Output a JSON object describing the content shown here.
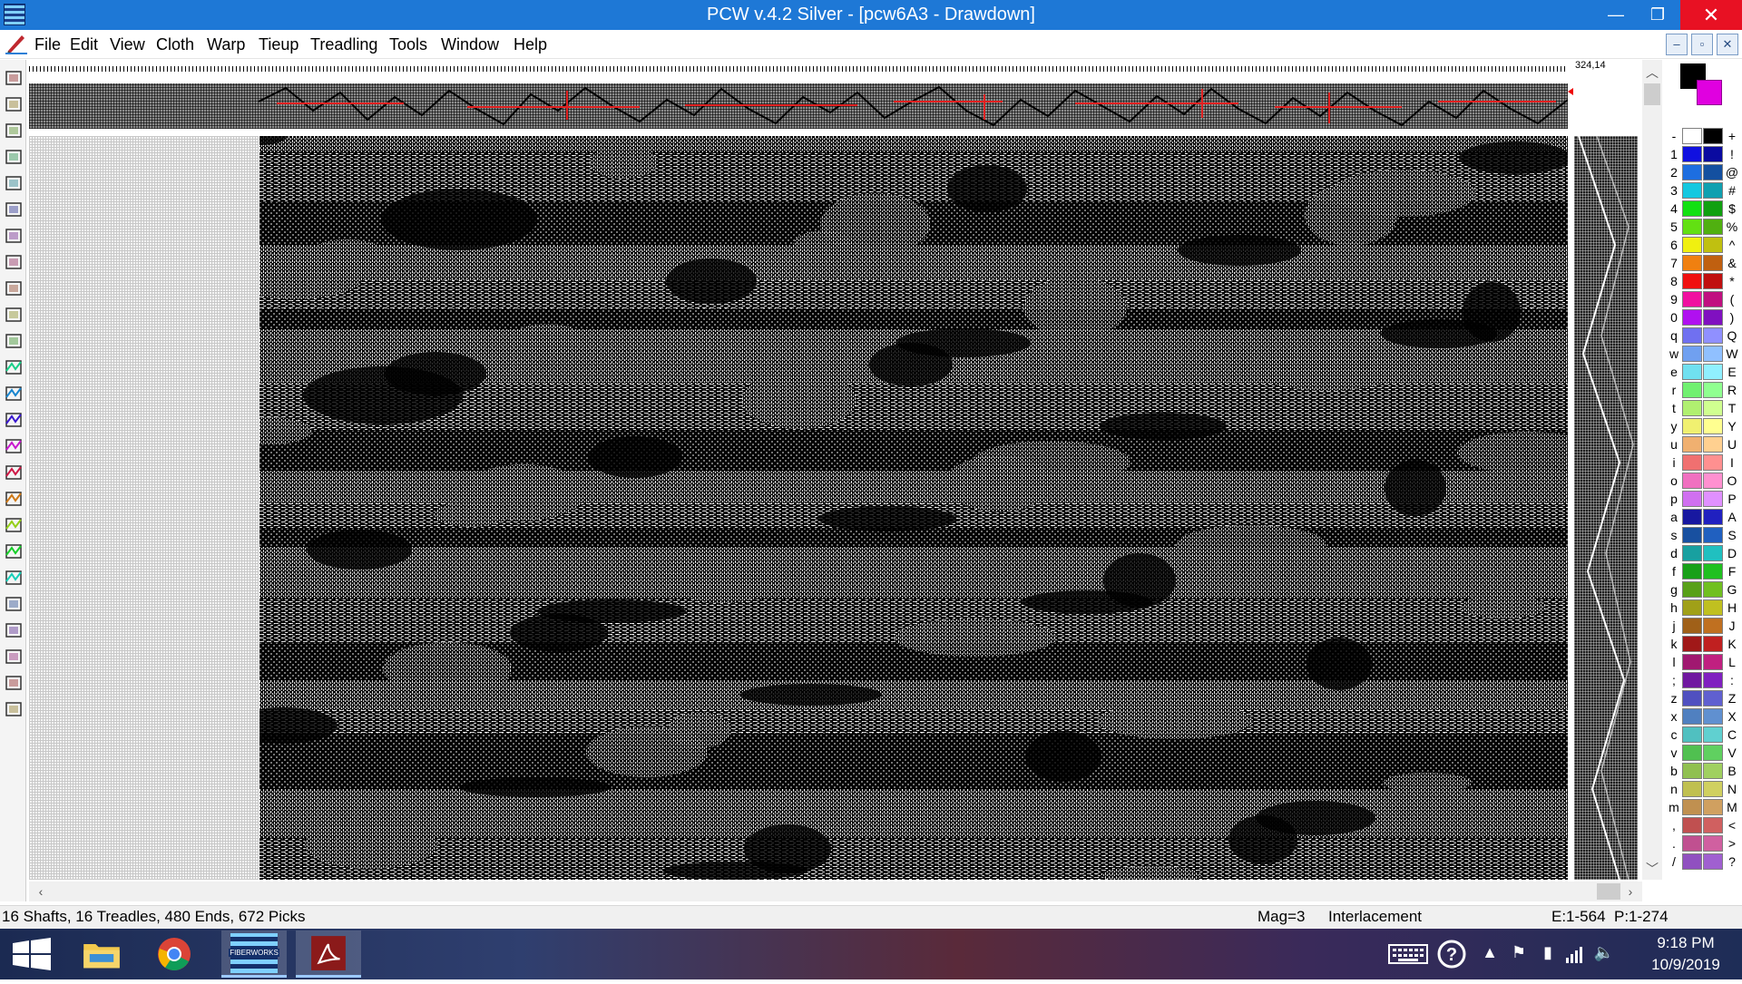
{
  "window": {
    "title": "PCW v.4.2 Silver - [pcw6A3 - Drawdown]",
    "minimize": "—",
    "restore": "❐",
    "close": "✕"
  },
  "menu": [
    "File",
    "Edit",
    "View",
    "Cloth",
    "Warp",
    "Tieup",
    "Treadling",
    "Tools",
    "Window",
    "Help"
  ],
  "mdi_buttons": [
    "–",
    "▫",
    "✕"
  ],
  "toolbar": {
    "icons": [
      "new-file-icon",
      "open-folder-icon",
      "save-icon",
      "print-icon",
      "undo-icon",
      "cut-icon",
      "copy-icon",
      "paste-icon",
      "color-block-icon",
      "select-rectangle-icon",
      "pencil-icon",
      "threading-pattern-1-icon",
      "threading-pattern-2-icon",
      "threading-pattern-3-icon",
      "threading-pattern-4-icon",
      "threading-pattern-5-icon",
      "mirror-pattern-icon",
      "repeat-pattern-icon",
      "weave-icon",
      "block-b-icon",
      "color-grid-icon",
      "color-stripe-icon",
      "zoom-in-icon",
      "zoom-out-icon",
      "help-pointer-icon"
    ]
  },
  "coord_readout": "324,14",
  "palette": {
    "left_keys": [
      "-",
      "1",
      "2",
      "3",
      "4",
      "5",
      "6",
      "7",
      "8",
      "9",
      "0",
      "q",
      "w",
      "e",
      "r",
      "t",
      "y",
      "u",
      "i",
      "o",
      "p",
      "a",
      "s",
      "d",
      "f",
      "g",
      "h",
      "j",
      "k",
      "l",
      ";",
      "z",
      "x",
      "c",
      "v",
      "b",
      "n",
      "m",
      ",",
      ".",
      " /"
    ],
    "right_keys": [
      "+",
      "!",
      "@",
      "#",
      "$",
      "%",
      "^",
      "&",
      "*",
      "(",
      ")",
      "Q",
      "W",
      "E",
      "R",
      "T",
      "Y",
      "U",
      "I",
      "O",
      "P",
      "A",
      "S",
      "D",
      "F",
      "G",
      "H",
      "J",
      "K",
      "L",
      ":",
      "Z",
      "X",
      "C",
      "V",
      "B",
      "N",
      "M",
      "<",
      ">",
      "?"
    ],
    "colors_a": [
      "#ffffff",
      "#1010e0",
      "#1d6ee0",
      "#14c8e0",
      "#12e012",
      "#62e012",
      "#f0f010",
      "#f08010",
      "#f01010",
      "#f010a0",
      "#b010f0",
      "#7070f0",
      "#70a0f0",
      "#70e0f0",
      "#70f070",
      "#b0f070",
      "#f0f070",
      "#f0b070",
      "#f07070",
      "#f070c0",
      "#d070f0",
      "#1818a0",
      "#1850a0",
      "#18a0a0",
      "#18a018",
      "#58a018",
      "#a0a018",
      "#a06018",
      "#a01818",
      "#a01870",
      "#7018a0",
      "#5050c0",
      "#5080c0",
      "#50c0c0",
      "#50c050",
      "#90c050",
      "#c0c050",
      "#c09050",
      "#c05050",
      "#c05090",
      "#9050c0"
    ],
    "colors_b": [
      "#000000",
      "#0a0aa0",
      "#1450a0",
      "#10a0b0",
      "#10a010",
      "#50b010",
      "#c0c010",
      "#c06010",
      "#c01010",
      "#c01080",
      "#8010c0",
      "#9090ff",
      "#90c0ff",
      "#90f0ff",
      "#90ff90",
      "#d0ff90",
      "#ffff90",
      "#ffd090",
      "#ff9090",
      "#ff90d0",
      "#e090ff",
      "#2020c0",
      "#2060c0",
      "#20c0c0",
      "#20c020",
      "#70c020",
      "#c0c020",
      "#c07020",
      "#c02020",
      "#c02080",
      "#8020c0",
      "#6060d0",
      "#6090d0",
      "#60d0d0",
      "#60d060",
      "#a0d060",
      "#d0d060",
      "#d0a060",
      "#d06060",
      "#d060a0",
      "#a060d0"
    ]
  },
  "status": {
    "summary": "16 Shafts, 16 Treadles, 480 Ends, 672 Picks",
    "mag": "Mag=3",
    "mode": "Interlacement",
    "position": "E:1-564  P:1-274"
  },
  "taskbar": {
    "apps": [
      {
        "name": "file-explorer",
        "label": ""
      },
      {
        "name": "chrome",
        "label": ""
      },
      {
        "name": "fiberworks",
        "label": "FIBERWORKS"
      },
      {
        "name": "acrobat",
        "label": ""
      }
    ],
    "time": "9:18 PM",
    "date": "10/9/2019"
  }
}
